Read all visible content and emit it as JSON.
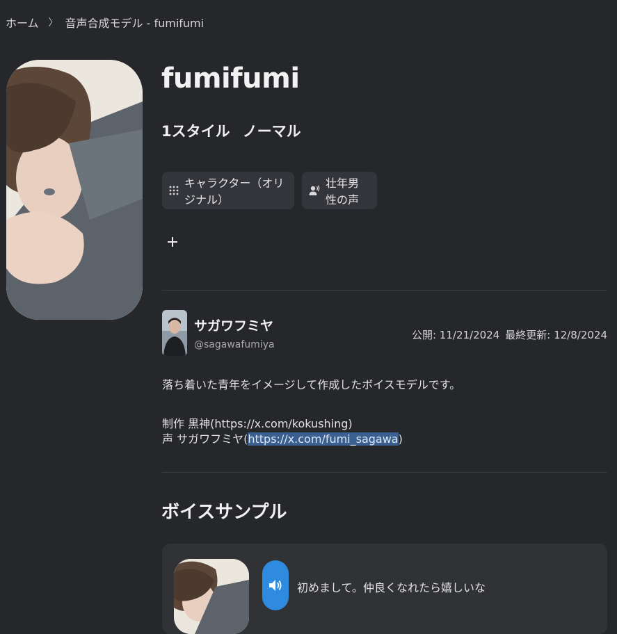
{
  "breadcrumb": {
    "home": "ホーム",
    "separator": "〉",
    "current": "音声合成モデル - fumifumi"
  },
  "model": {
    "title": "fumifumi",
    "style_count": "1スタイル",
    "style_name": "ノーマル"
  },
  "tags": [
    {
      "label": "キャラクター（オリジナル）",
      "icon": "grid-dots-icon"
    },
    {
      "label": "壮年男性の声",
      "icon": "voice-person-icon"
    }
  ],
  "add_tag_label": "+",
  "author": {
    "name": "サガワフミヤ",
    "handle": "@sagawafumiya"
  },
  "dates": {
    "published_label": "公開: 11/21/2024",
    "updated_label": "最終更新: 12/8/2024"
  },
  "description": {
    "line1": "落ち着いた青年をイメージして作成したボイスモデルです。",
    "line2": "制作 黒神(https://x.com/kokushing)",
    "line3_prefix": "声 サガワフミヤ(",
    "line3_link": "https://x.com/fumi_sagawa",
    "line3_suffix": ")"
  },
  "samples": {
    "section_title": "ボイスサンプル",
    "items": [
      {
        "text": "初めまして。仲良くなれたら嬉しいな"
      }
    ]
  },
  "colors": {
    "background": "#26272b",
    "chip": "#34353a",
    "card": "#313236",
    "accent_play": "#2f8be0",
    "link_highlight": "#3b5f8f"
  }
}
